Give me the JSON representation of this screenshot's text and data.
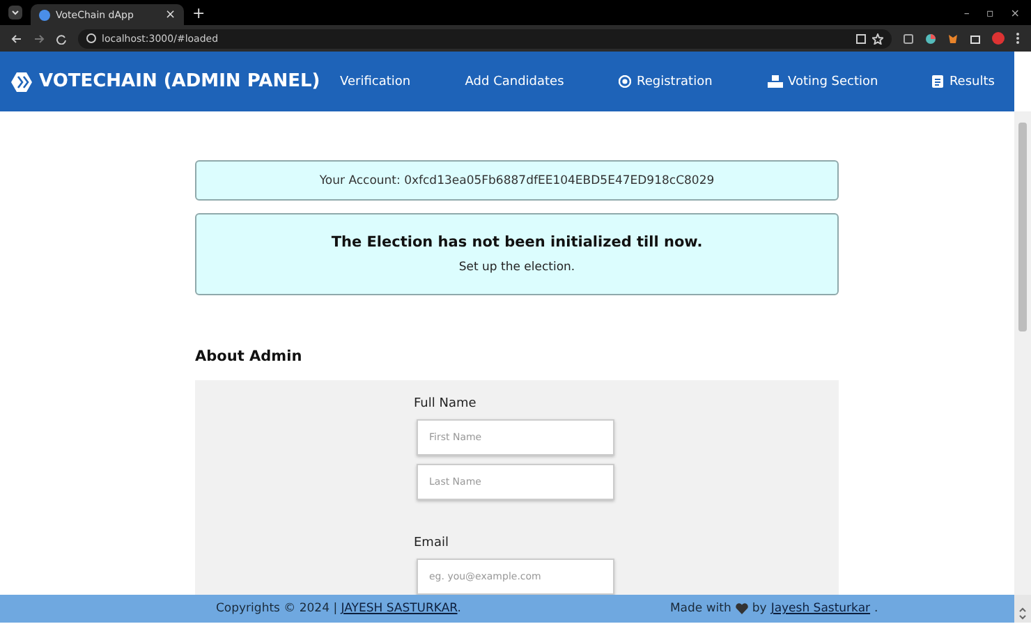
{
  "browser": {
    "tab_title": "VoteChain dApp",
    "tab_close": "×",
    "new_tab": "+",
    "address": "localhost:3000/#loaded",
    "window_controls": [
      "–",
      "▫",
      "×"
    ]
  },
  "navbar": {
    "brand": "VOTECHAIN (ADMIN PANEL)",
    "links": [
      {
        "label": "Verification",
        "kind": "plain"
      },
      {
        "label": "Add Candidates",
        "kind": "plain"
      },
      {
        "label": "Registration",
        "kind": "circle"
      },
      {
        "label": "Voting Section",
        "kind": "ballot"
      },
      {
        "label": "Results",
        "kind": "document"
      }
    ]
  },
  "account": {
    "text": "Your Account: 0xfcd13ea05Fb6887dfEE104EBD5E47ED918cC8029"
  },
  "notice": {
    "title": "The Election has not been initialized till now.",
    "subtitle": "Set up the election."
  },
  "about": {
    "heading": "About Admin",
    "fields": [
      {
        "label": "Full Name",
        "inputs": [
          {
            "placeholder": "First Name"
          },
          {
            "placeholder": "Last Name"
          }
        ]
      },
      {
        "label": "Email",
        "inputs": [
          {
            "placeholder": "eg. you@example.com"
          }
        ]
      }
    ]
  },
  "footer": {
    "left_prefix": "Copyrights © 2024 | ",
    "left_link": "JAYESH SASTURKAR",
    "left_suffix": ".",
    "right_prefix": "Made with",
    "right_middle": "by",
    "right_link": "Jayesh Sasturkar",
    "right_suffix": "."
  }
}
